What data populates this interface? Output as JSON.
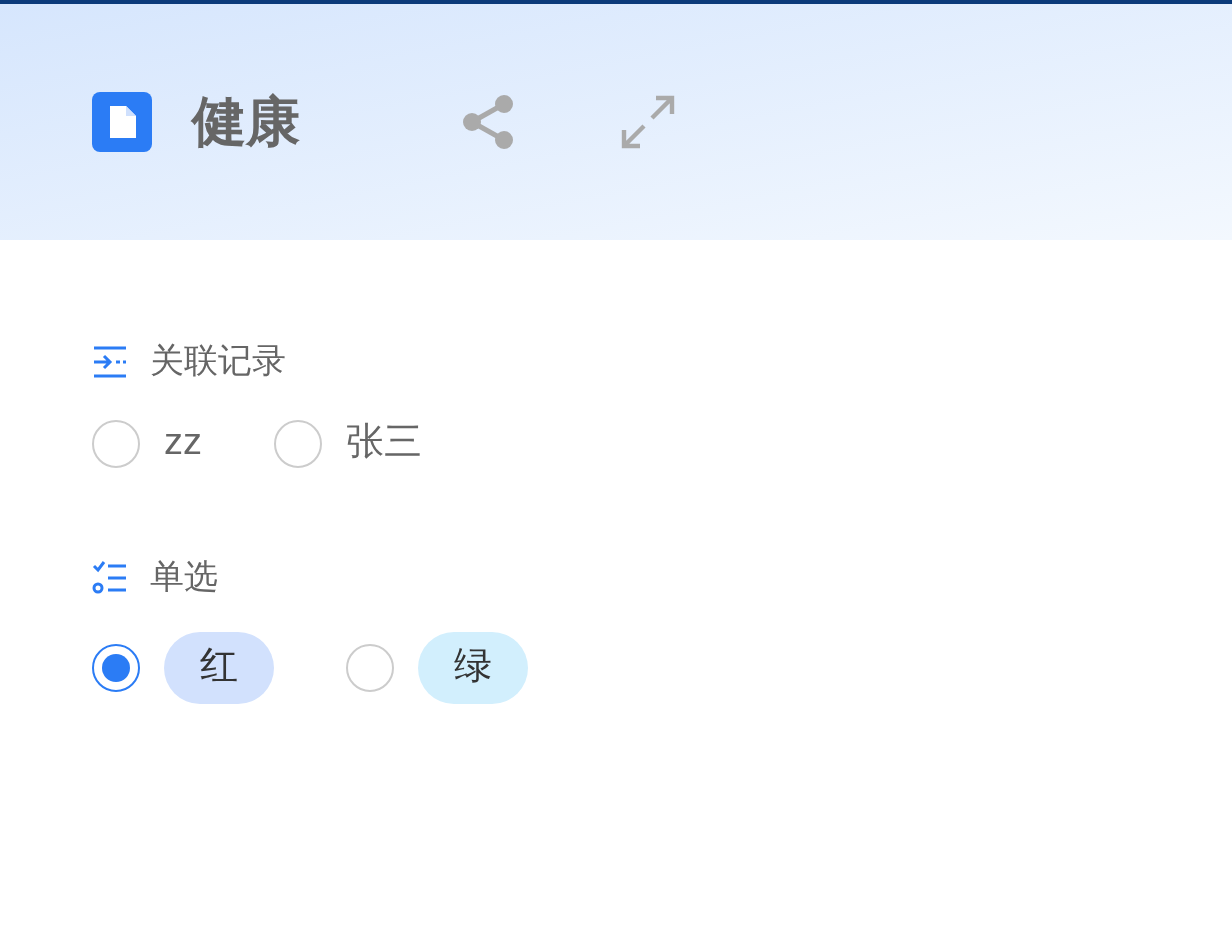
{
  "header": {
    "title": "健康"
  },
  "fields": [
    {
      "kind": "relation",
      "label": "关联记录",
      "options": [
        {
          "label": "zz",
          "selected": false
        },
        {
          "label": "张三",
          "selected": false
        }
      ]
    },
    {
      "kind": "choice",
      "label": "单选",
      "options": [
        {
          "label": "红",
          "selected": true,
          "color": "#d2e1fd"
        },
        {
          "label": "绿",
          "selected": false,
          "color": "#d2effd"
        }
      ]
    }
  ]
}
